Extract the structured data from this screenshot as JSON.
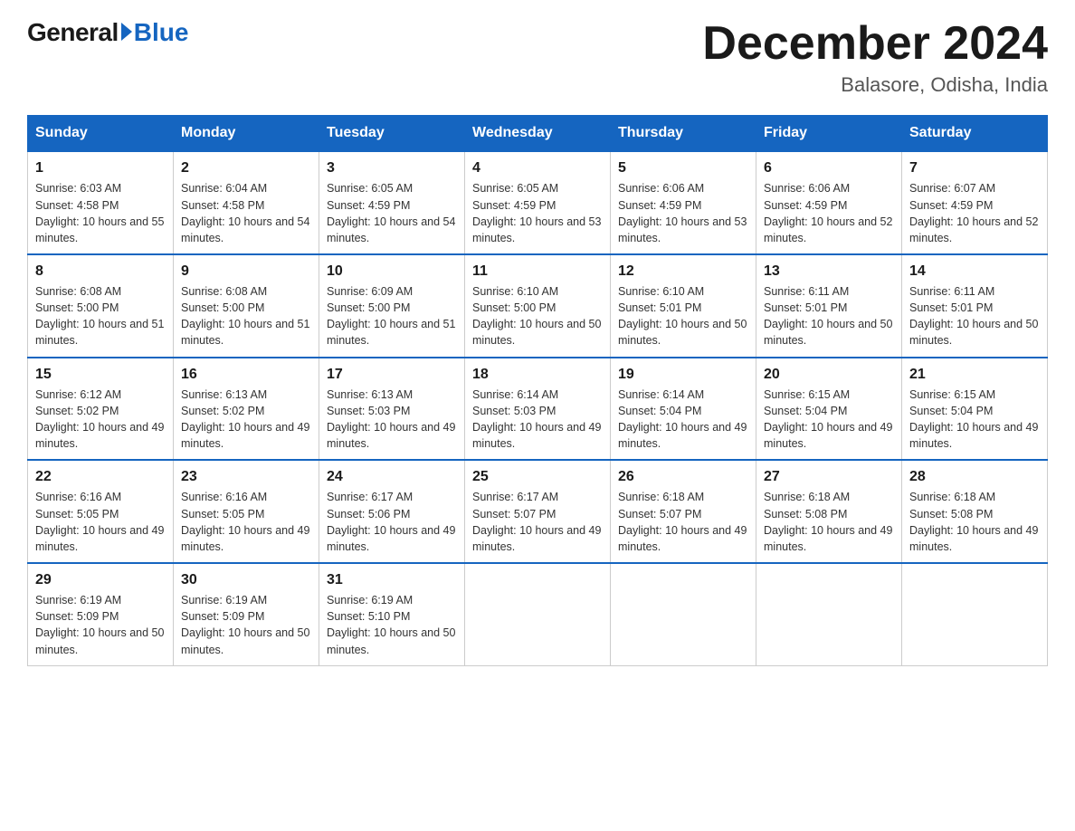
{
  "header": {
    "logo": {
      "general": "General",
      "blue": "Blue"
    },
    "title": "December 2024",
    "location": "Balasore, Odisha, India"
  },
  "calendar": {
    "days_of_week": [
      "Sunday",
      "Monday",
      "Tuesday",
      "Wednesday",
      "Thursday",
      "Friday",
      "Saturday"
    ],
    "weeks": [
      [
        {
          "day": "1",
          "sunrise": "6:03 AM",
          "sunset": "4:58 PM",
          "daylight": "10 hours and 55 minutes."
        },
        {
          "day": "2",
          "sunrise": "6:04 AM",
          "sunset": "4:58 PM",
          "daylight": "10 hours and 54 minutes."
        },
        {
          "day": "3",
          "sunrise": "6:05 AM",
          "sunset": "4:59 PM",
          "daylight": "10 hours and 54 minutes."
        },
        {
          "day": "4",
          "sunrise": "6:05 AM",
          "sunset": "4:59 PM",
          "daylight": "10 hours and 53 minutes."
        },
        {
          "day": "5",
          "sunrise": "6:06 AM",
          "sunset": "4:59 PM",
          "daylight": "10 hours and 53 minutes."
        },
        {
          "day": "6",
          "sunrise": "6:06 AM",
          "sunset": "4:59 PM",
          "daylight": "10 hours and 52 minutes."
        },
        {
          "day": "7",
          "sunrise": "6:07 AM",
          "sunset": "4:59 PM",
          "daylight": "10 hours and 52 minutes."
        }
      ],
      [
        {
          "day": "8",
          "sunrise": "6:08 AM",
          "sunset": "5:00 PM",
          "daylight": "10 hours and 51 minutes."
        },
        {
          "day": "9",
          "sunrise": "6:08 AM",
          "sunset": "5:00 PM",
          "daylight": "10 hours and 51 minutes."
        },
        {
          "day": "10",
          "sunrise": "6:09 AM",
          "sunset": "5:00 PM",
          "daylight": "10 hours and 51 minutes."
        },
        {
          "day": "11",
          "sunrise": "6:10 AM",
          "sunset": "5:00 PM",
          "daylight": "10 hours and 50 minutes."
        },
        {
          "day": "12",
          "sunrise": "6:10 AM",
          "sunset": "5:01 PM",
          "daylight": "10 hours and 50 minutes."
        },
        {
          "day": "13",
          "sunrise": "6:11 AM",
          "sunset": "5:01 PM",
          "daylight": "10 hours and 50 minutes."
        },
        {
          "day": "14",
          "sunrise": "6:11 AM",
          "sunset": "5:01 PM",
          "daylight": "10 hours and 50 minutes."
        }
      ],
      [
        {
          "day": "15",
          "sunrise": "6:12 AM",
          "sunset": "5:02 PM",
          "daylight": "10 hours and 49 minutes."
        },
        {
          "day": "16",
          "sunrise": "6:13 AM",
          "sunset": "5:02 PM",
          "daylight": "10 hours and 49 minutes."
        },
        {
          "day": "17",
          "sunrise": "6:13 AM",
          "sunset": "5:03 PM",
          "daylight": "10 hours and 49 minutes."
        },
        {
          "day": "18",
          "sunrise": "6:14 AM",
          "sunset": "5:03 PM",
          "daylight": "10 hours and 49 minutes."
        },
        {
          "day": "19",
          "sunrise": "6:14 AM",
          "sunset": "5:04 PM",
          "daylight": "10 hours and 49 minutes."
        },
        {
          "day": "20",
          "sunrise": "6:15 AM",
          "sunset": "5:04 PM",
          "daylight": "10 hours and 49 minutes."
        },
        {
          "day": "21",
          "sunrise": "6:15 AM",
          "sunset": "5:04 PM",
          "daylight": "10 hours and 49 minutes."
        }
      ],
      [
        {
          "day": "22",
          "sunrise": "6:16 AM",
          "sunset": "5:05 PM",
          "daylight": "10 hours and 49 minutes."
        },
        {
          "day": "23",
          "sunrise": "6:16 AM",
          "sunset": "5:05 PM",
          "daylight": "10 hours and 49 minutes."
        },
        {
          "day": "24",
          "sunrise": "6:17 AM",
          "sunset": "5:06 PM",
          "daylight": "10 hours and 49 minutes."
        },
        {
          "day": "25",
          "sunrise": "6:17 AM",
          "sunset": "5:07 PM",
          "daylight": "10 hours and 49 minutes."
        },
        {
          "day": "26",
          "sunrise": "6:18 AM",
          "sunset": "5:07 PM",
          "daylight": "10 hours and 49 minutes."
        },
        {
          "day": "27",
          "sunrise": "6:18 AM",
          "sunset": "5:08 PM",
          "daylight": "10 hours and 49 minutes."
        },
        {
          "day": "28",
          "sunrise": "6:18 AM",
          "sunset": "5:08 PM",
          "daylight": "10 hours and 49 minutes."
        }
      ],
      [
        {
          "day": "29",
          "sunrise": "6:19 AM",
          "sunset": "5:09 PM",
          "daylight": "10 hours and 50 minutes."
        },
        {
          "day": "30",
          "sunrise": "6:19 AM",
          "sunset": "5:09 PM",
          "daylight": "10 hours and 50 minutes."
        },
        {
          "day": "31",
          "sunrise": "6:19 AM",
          "sunset": "5:10 PM",
          "daylight": "10 hours and 50 minutes."
        },
        null,
        null,
        null,
        null
      ]
    ]
  }
}
